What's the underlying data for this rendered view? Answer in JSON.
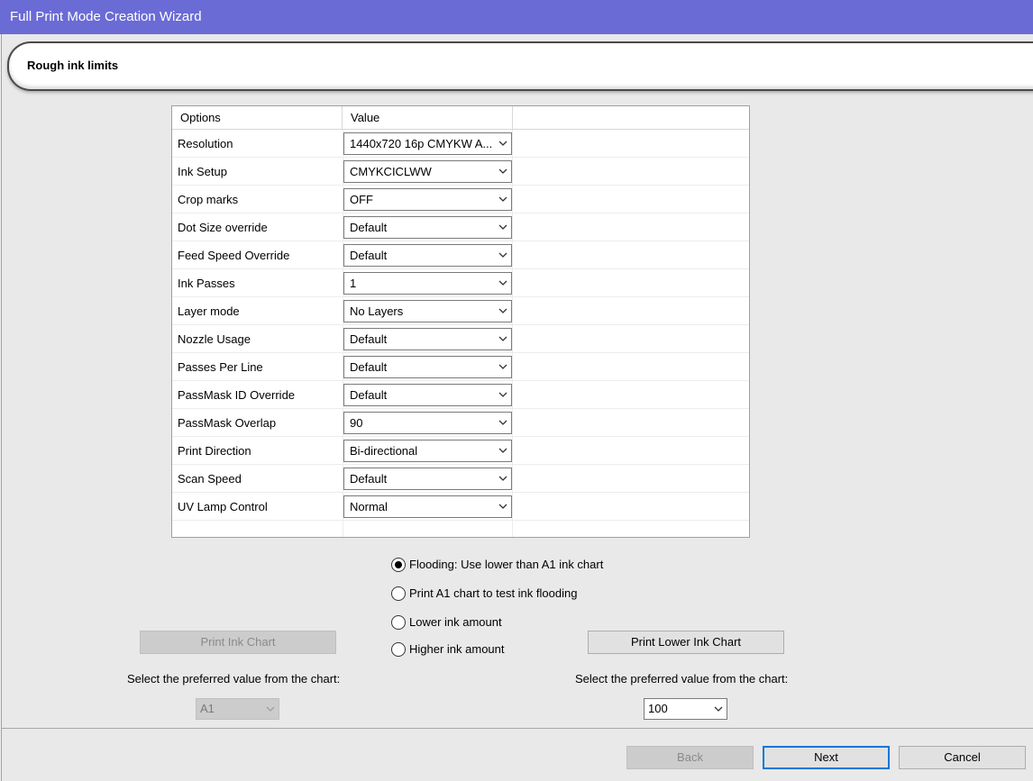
{
  "window": {
    "title": "Full Print Mode Creation Wizard"
  },
  "header": {
    "title": "Rough ink limits"
  },
  "grid": {
    "columns": [
      "Options",
      "Value"
    ],
    "rows": [
      {
        "option": "Resolution",
        "value": "1440x720 16p CMYKW A..."
      },
      {
        "option": "Ink Setup",
        "value": "CMYKCICLWW"
      },
      {
        "option": "Crop marks",
        "value": "OFF"
      },
      {
        "option": "Dot Size override",
        "value": "Default"
      },
      {
        "option": "Feed Speed Override",
        "value": "Default"
      },
      {
        "option": "Ink Passes",
        "value": "1"
      },
      {
        "option": "Layer mode",
        "value": "No Layers"
      },
      {
        "option": "Nozzle Usage",
        "value": "Default"
      },
      {
        "option": "Passes Per Line",
        "value": "Default"
      },
      {
        "option": "PassMask ID Override",
        "value": "Default"
      },
      {
        "option": "PassMask Overlap",
        "value": "90"
      },
      {
        "option": "Print Direction",
        "value": "Bi-directional"
      },
      {
        "option": "Scan Speed",
        "value": "Default"
      },
      {
        "option": "UV Lamp Control",
        "value": "Normal"
      }
    ]
  },
  "radios": [
    {
      "label": "Flooding: Use lower than A1 ink chart",
      "checked": true
    },
    {
      "label": "Print A1 chart to test ink flooding",
      "checked": false
    },
    {
      "label": "Lower ink amount",
      "checked": false
    },
    {
      "label": "Higher ink amount",
      "checked": false
    }
  ],
  "left_panel": {
    "button_label": "Print Ink Chart",
    "prompt": "Select the preferred value from the chart:",
    "selected": "A1"
  },
  "right_panel": {
    "button_label": "Print Lower Ink Chart",
    "prompt": "Select the preferred value from the chart:",
    "selected": "100"
  },
  "footer": {
    "back_label": "Back",
    "next_label": "Next",
    "cancel_label": "Cancel"
  },
  "icons": {
    "dropdown": "chevron-down-icon",
    "radio": "radio-icon"
  },
  "colors": {
    "titlebar": "#6b6bd6",
    "default_button_border": "#0078d7"
  }
}
